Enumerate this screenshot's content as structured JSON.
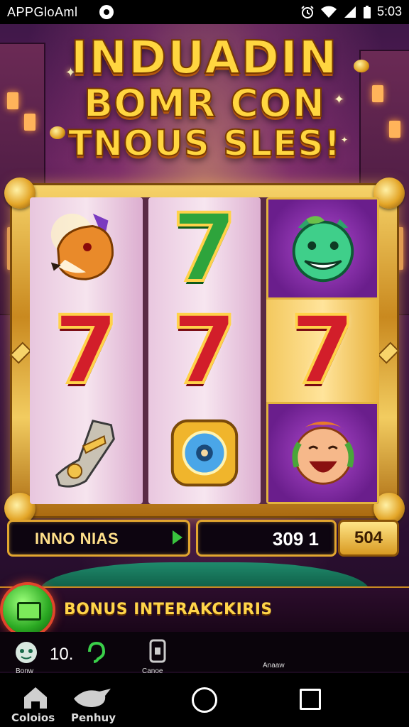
{
  "status_bar": {
    "app_name": "APPGloAml",
    "time": "5:03",
    "icons": [
      "alarm-icon",
      "wifi-icon",
      "signal-icon",
      "battery-icon"
    ]
  },
  "promo": {
    "line1": "INDUADIN",
    "line2": "BOMR CON",
    "line3": "TNOUS SLES!"
  },
  "reels": [
    [
      "fox-symbol",
      "seven-symbol",
      "boot-symbol"
    ],
    [
      "green-seven-symbol",
      "seven-symbol",
      "gem-ring-symbol"
    ],
    [
      "green-monster-symbol",
      "seven-symbol",
      "laughing-face-symbol"
    ]
  ],
  "seven_glyph": "7",
  "controls": {
    "bet_label": "INNO NIAS",
    "win_value": "309 1",
    "credits_value": "504"
  },
  "bonus": {
    "label": "BONUS INTERAKCKIRIS"
  },
  "utility": {
    "count": "10.",
    "left_label": "Bonw",
    "mid_label": "Canoe",
    "right_label": "Anaaw"
  },
  "nav": {
    "left_label": "Coloios",
    "mid_label": "Penhuy"
  },
  "colors": {
    "gold": "#ffd640",
    "accent_red": "#d21e2a",
    "accent_green": "#2ea43c",
    "background": "#3a1646"
  }
}
